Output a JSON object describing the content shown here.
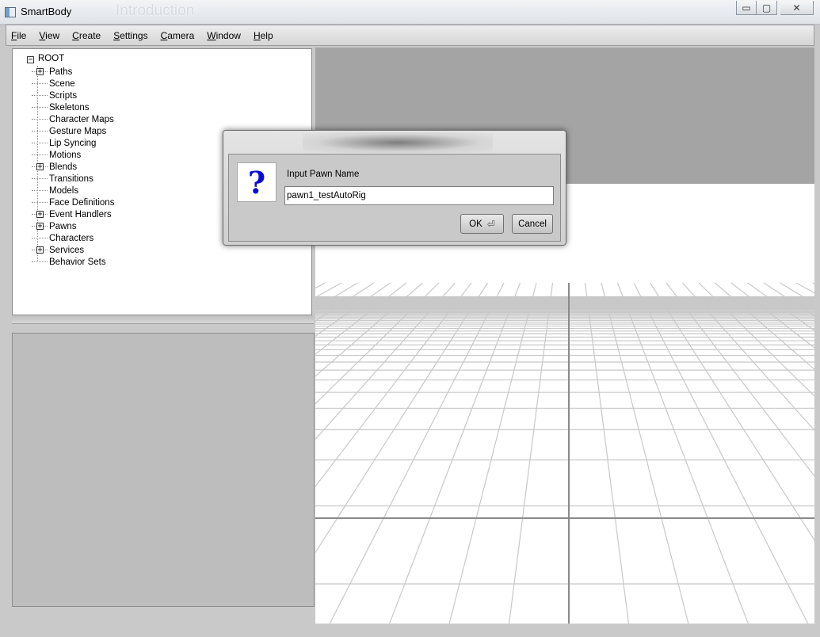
{
  "window": {
    "title": "SmartBody",
    "background_title": "Introduction",
    "controls": {
      "minimize": "▭",
      "maximize": "▢",
      "close": "✕"
    }
  },
  "menubar": {
    "items": [
      "File",
      "View",
      "Create",
      "Settings",
      "Camera",
      "Window",
      "Help"
    ]
  },
  "tree": {
    "root": "ROOT",
    "items": [
      {
        "label": "Paths",
        "expandable": true
      },
      {
        "label": "Scene",
        "expandable": false
      },
      {
        "label": "Scripts",
        "expandable": false
      },
      {
        "label": "Skeletons",
        "expandable": false
      },
      {
        "label": "Character Maps",
        "expandable": false
      },
      {
        "label": "Gesture Maps",
        "expandable": false
      },
      {
        "label": "Lip Syncing",
        "expandable": false
      },
      {
        "label": "Motions",
        "expandable": false
      },
      {
        "label": "Blends",
        "expandable": true
      },
      {
        "label": "Transitions",
        "expandable": false
      },
      {
        "label": "Models",
        "expandable": false
      },
      {
        "label": "Face Definitions",
        "expandable": false
      },
      {
        "label": "Event Handlers",
        "expandable": true
      },
      {
        "label": "Pawns",
        "expandable": true
      },
      {
        "label": "Characters",
        "expandable": false
      },
      {
        "label": "Services",
        "expandable": true
      },
      {
        "label": "Behavior Sets",
        "expandable": false
      }
    ]
  },
  "dialog": {
    "icon": "question-mark-icon",
    "icon_glyph": "?",
    "prompt": "Input Pawn Name",
    "input_value": "pawn1_testAutoRig",
    "ok_label": "OK",
    "ok_icon": "⏎",
    "cancel_label": "Cancel"
  },
  "colors": {
    "question_mark": "#0a0ad8",
    "viewport_sky": "#a4a4a4",
    "grid": "#c8c8c8",
    "axis": "#8a8a8a"
  }
}
